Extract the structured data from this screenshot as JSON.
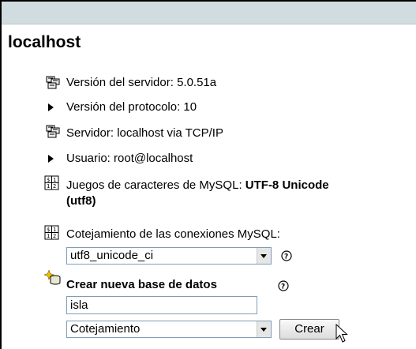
{
  "server": {
    "title": "localhost",
    "server_version": "Versión del servidor: 5.0.51a",
    "protocol_version": "Versión del protocolo: 10",
    "server_connection": "Servidor: localhost via TCP/IP",
    "user": "Usuario: root@localhost",
    "charset_label": "Juegos de caracteres de MySQL: ",
    "charset_value": "UTF-8 Unicode",
    "charset_value_2": "(utf8)",
    "collation_label": "Cotejamiento de las conexiones MySQL:",
    "collation_value": "utf8_unicode_ci"
  },
  "create_db": {
    "label": "Crear nueva base de datos",
    "name_value": "isla",
    "collation_select": "Cotejamiento",
    "create_button": "Crear"
  },
  "icons": {
    "server": "server-stack-icon",
    "charset": "charset-table-icon",
    "help": "help-circle-icon",
    "new_db": "new-database-sparkle-icon",
    "bullet": "triangle-bullet-icon",
    "cursor": "mouse-pointer-icon"
  }
}
